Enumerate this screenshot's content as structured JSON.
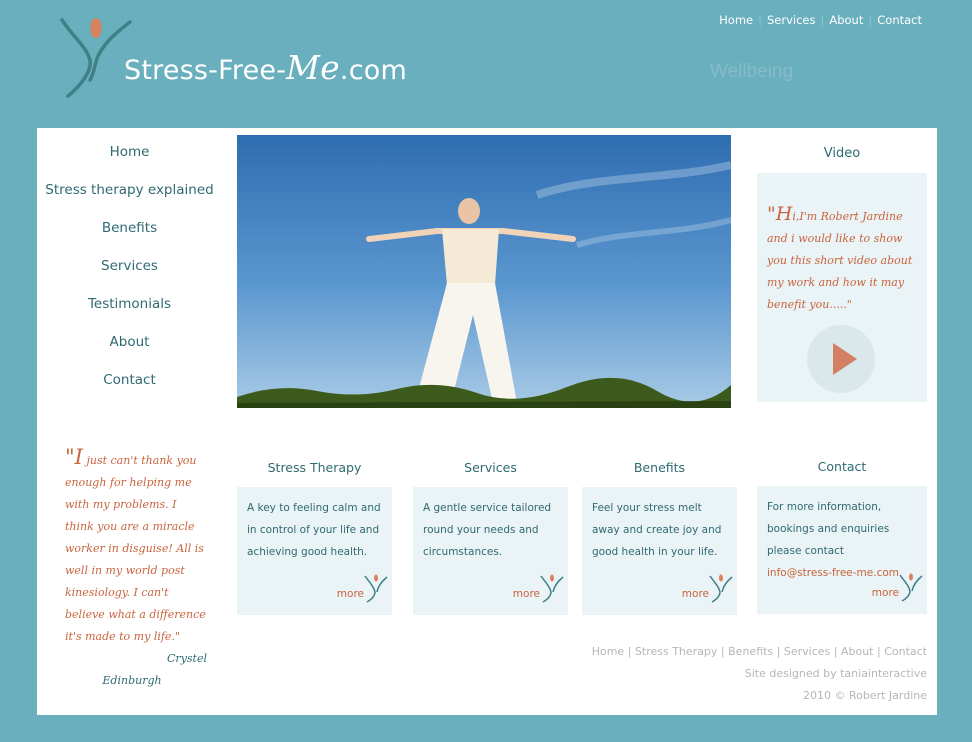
{
  "header": {
    "logo_text_prefix": "Stress-Free-",
    "logo_text_me": "Me",
    "logo_text_suffix": ".com",
    "tagline": "Wellbeing",
    "top_nav": [
      "Home",
      "Services",
      "About",
      "Contact"
    ]
  },
  "sidebar": {
    "items": [
      {
        "label": "Home"
      },
      {
        "label": "Stress therapy explained"
      },
      {
        "label": "Benefits"
      },
      {
        "label": "Services"
      },
      {
        "label": "Testimonials"
      },
      {
        "label": "About"
      },
      {
        "label": "Contact"
      }
    ]
  },
  "video": {
    "title": "Video",
    "quote_first": "H",
    "quote_rest": "i,I'm Robert Jardine and i would like to show you this short video about my work and how it may benefit you.....\""
  },
  "testimonial": {
    "quote_first": "I",
    "quote_rest": " just can't thank you enough for helping me with my problems. I think you are a miracle worker in disguise! All is well in my world post kinesiology. I can't believe what a difference it's made to my life.\"",
    "author": "Crystel",
    "location": "Edinburgh"
  },
  "sections": [
    {
      "title": "Stress Therapy",
      "text": "A key to feeling calm and in control of your life and achieving good health.",
      "more": "more"
    },
    {
      "title": "Services",
      "text": "A gentle service tailored round your needs and circumstances.",
      "more": "more"
    },
    {
      "title": "Benefits",
      "text": "Feel your stress melt away and create joy and good health in your life.",
      "more": "more"
    },
    {
      "title": "Contact",
      "text": "For more information, bookings and enquiries please contact",
      "email": "info@stress-free-me.com",
      "more": "more"
    }
  ],
  "footer": {
    "links": [
      "Home",
      "Stress Therapy",
      "Benefits",
      "Services",
      "About",
      "Contact"
    ],
    "designed_by": "Site designed by taniainteractive",
    "copyright": "2010 © Robert Jardine"
  },
  "colors": {
    "background": "#6aafbd",
    "accent": "#c8643e",
    "text": "#2f6a72",
    "card": "#eaf3f5"
  }
}
